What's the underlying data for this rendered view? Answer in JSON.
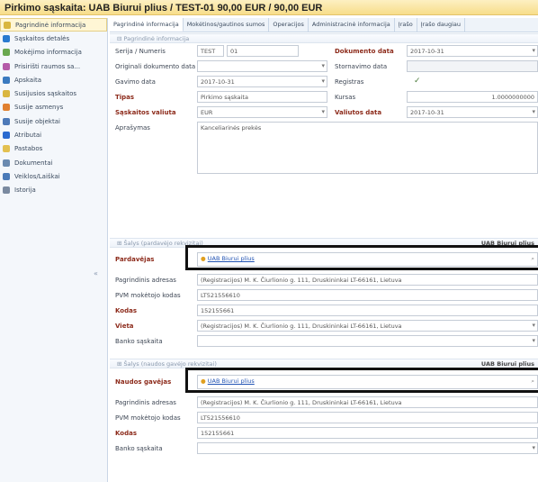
{
  "title": "Pirkimo sąskaita: UAB Biurui plius / TEST-01 90,00 EUR / 90,00 EUR",
  "sidebar": [
    {
      "label": "Pagrindinė informacija",
      "icon": "page-icon",
      "color": "#d9b640"
    },
    {
      "label": "Sąskaitos detalės",
      "icon": "globe-icon",
      "color": "#2a7ad0"
    },
    {
      "label": "Mokėjimo informacija",
      "icon": "wand-icon",
      "color": "#6aa84f"
    },
    {
      "label": "Prisirišti raumos sa...",
      "icon": "pencil-icon",
      "color": "#b45aa8"
    },
    {
      "label": "Apskaita",
      "icon": "coin-icon",
      "color": "#3a7ac0"
    },
    {
      "label": "Susijusios sąskaitos",
      "icon": "page-icon",
      "color": "#d9b640"
    },
    {
      "label": "Susije asmenys",
      "icon": "people-icon",
      "color": "#e08030"
    },
    {
      "label": "Susije objektai",
      "icon": "link-icon",
      "color": "#4d79b8"
    },
    {
      "label": "Atributai",
      "icon": "tag-icon",
      "color": "#2a6ad0"
    },
    {
      "label": "Pastabos",
      "icon": "note-icon",
      "color": "#e3c050"
    },
    {
      "label": "Dokumentai",
      "icon": "doc-icon",
      "color": "#6a8ab0"
    },
    {
      "label": "Veiklos/Laiškai",
      "icon": "doc-icon",
      "color": "#4a7ab8"
    },
    {
      "label": "Istorija",
      "icon": "doc-icon",
      "color": "#7a8aa0"
    }
  ],
  "collapse_glyph": "«",
  "tabs": [
    "Pagrindinė informacija",
    "Mokėtinos/gautinos sumos",
    "Operacijos",
    "Administracinė informacija",
    "Įrašo ",
    "Įrašo daugiau"
  ],
  "section1": "Pagrindinė informacija",
  "fields": {
    "serija_label": "Serija / Numeris",
    "serija": "TEST",
    "numeris": "01",
    "orig_label": "Originali dokumento data",
    "gavimo_label": "Gavimo data",
    "gavimo": "2017-10-31",
    "tipas_label": "Tipas",
    "tipas": "Pirkimo sąskaita",
    "valiuta_label": "Sąskaitos valiuta",
    "valiuta": "EUR",
    "aprasymas_label": "Aprašymas",
    "aprasymas": "Kanceliarinės prekės",
    "dok_data_label": "Dokumento data",
    "dok_data": "2017-10-31",
    "storno_label": "Stornavimo data",
    "reg_label": "Registras",
    "reg_check": "✓",
    "kursas_label": "Kursas",
    "kursas": "1.0000000000",
    "val_data_label": "Valiutos data",
    "val_data": "2017-10-31"
  },
  "section2": {
    "title": "Šalys (pardavėjo rekvizitai)",
    "right": "UAB Biurui plius"
  },
  "seller": {
    "label": "Pardavėjas",
    "name": "UAB Biurui plius",
    "addr_label": "Pagrindinis adresas",
    "addr": "(Registracijos) M. K. Čiurlionio g. 111, Druskininkai LT-66161, Lietuva",
    "pvm_label": "PVM mokėtojo kodas",
    "pvm": "LT521556610",
    "kodas_label": "Kodas",
    "kodas": "152155661",
    "vieta_label": "Vieta",
    "vieta": "(Registracijos) M. K. Čiurlionio g. 111, Druskininkai LT-66161, Lietuva",
    "banko_label": "Banko sąskaita"
  },
  "section3": {
    "title": "Šalys (naudos gavėjo rekvizitai)",
    "right": "UAB Biurui plius"
  },
  "receiver": {
    "label": "Naudos gavėjas",
    "name": "UAB Biurui plius",
    "addr_label": "Pagrindinis adresas",
    "addr": "(Registracijos) M. K. Čiurlionio g. 111, Druskininkai LT-66161, Lietuva",
    "pvm_label": "PVM mokėtojo kodas",
    "pvm": "LT521556610",
    "kodas_label": "Kodas",
    "kodas": "152155661",
    "banko_label": "Banko sąskaita"
  }
}
